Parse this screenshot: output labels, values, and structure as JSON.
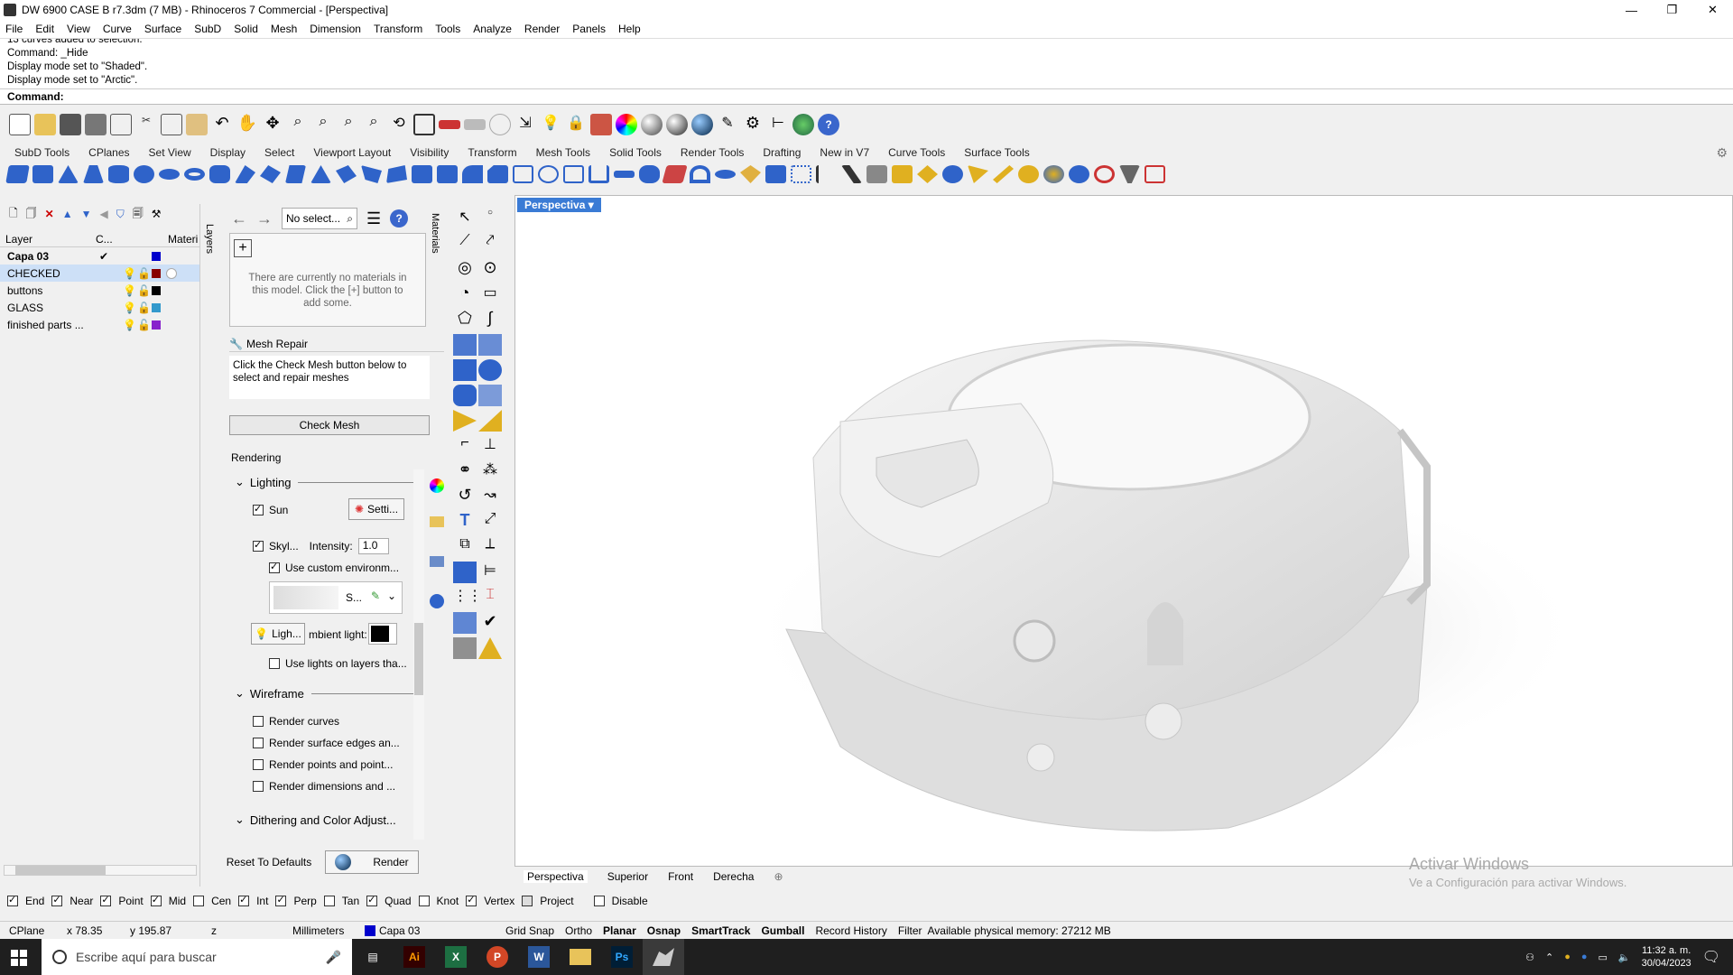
{
  "window": {
    "title": "DW 6900 CASE B r7.3dm (7 MB) - Rhinoceros 7 Commercial - [Perspectiva]",
    "controls": [
      "—",
      "❐",
      "✕"
    ]
  },
  "menu": [
    "File",
    "Edit",
    "View",
    "Curve",
    "Surface",
    "SubD",
    "Solid",
    "Mesh",
    "Dimension",
    "Transform",
    "Tools",
    "Analyze",
    "Render",
    "Panels",
    "Help"
  ],
  "command_history": [
    "13 curves added to selection.",
    "Command: _Hide",
    "Display mode set to \"Shaded\".",
    "Display mode set to \"Arctic\"."
  ],
  "command_prompt": "Command:",
  "toolbar_tabs": [
    "SubD Tools",
    "CPlanes",
    "Set View",
    "Display",
    "Select",
    "Viewport Layout",
    "Visibility",
    "Transform",
    "Mesh Tools",
    "Solid Tools",
    "Render Tools",
    "Drafting",
    "New in V7",
    "Curve Tools",
    "Surface Tools"
  ],
  "layers": {
    "headers": [
      "Layer",
      "C...",
      "Materi"
    ],
    "rows": [
      {
        "name": "Capa 03",
        "color": "#0000cc",
        "current": true
      },
      {
        "name": "CHECKED",
        "color": "#880000",
        "selected": true
      },
      {
        "name": "buttons",
        "color": "#000000"
      },
      {
        "name": "GLASS",
        "color": "#3399cc"
      },
      {
        "name": "finished parts ...",
        "color": "#8822cc"
      }
    ],
    "side_tab": "Layers"
  },
  "materials": {
    "search_placeholder": "No select...",
    "side_tab": "Materials",
    "empty_text": "There are currently no materials in this model. Click the [+] button to add some."
  },
  "mesh_repair": {
    "title": "Mesh Repair",
    "text": "Click the Check Mesh button below to select and repair meshes",
    "button": "Check Mesh"
  },
  "rendering": {
    "title": "Rendering",
    "lighting": "Lighting",
    "sun": "Sun",
    "sun_settings": "Setti...",
    "skylight": "Skyl...",
    "intensity_label": "Intensity:",
    "intensity_value": "1.0",
    "custom_env": "Use custom environm...",
    "env_label": "S...",
    "lights_btn": "Ligh...",
    "ambient": "mbient light:",
    "use_layers": "Use lights on layers tha...",
    "wireframe": "Wireframe",
    "render_curves": "Render curves",
    "render_edges": "Render surface edges an...",
    "render_points": "Render points and point...",
    "render_dims": "Render dimensions and ...",
    "dithering": "Dithering and Color Adjust...",
    "reset": "Reset To Defaults",
    "render_btn": "Render"
  },
  "viewport": {
    "active_tab": "Perspectiva",
    "tabs": [
      "Perspectiva",
      "Superior",
      "Front",
      "Derecha"
    ],
    "watermark_title": "Activar Windows",
    "watermark_sub": "Ve a Configuración para activar Windows."
  },
  "osnap": [
    {
      "label": "End",
      "on": true
    },
    {
      "label": "Near",
      "on": true
    },
    {
      "label": "Point",
      "on": true
    },
    {
      "label": "Mid",
      "on": true
    },
    {
      "label": "Cen",
      "on": false
    },
    {
      "label": "Int",
      "on": true
    },
    {
      "label": "Perp",
      "on": true
    },
    {
      "label": "Tan",
      "on": false
    },
    {
      "label": "Quad",
      "on": true
    },
    {
      "label": "Knot",
      "on": false
    },
    {
      "label": "Vertex",
      "on": true
    },
    {
      "label": "Project",
      "on": false
    },
    {
      "label": "Disable",
      "on": false
    }
  ],
  "status": {
    "cplane": "CPlane",
    "x": "x 78.35",
    "y": "y 195.87",
    "z": "z",
    "units": "Millimeters",
    "layer": "Capa 03",
    "toggles": [
      "Grid Snap",
      "Ortho",
      "Planar",
      "Osnap",
      "SmartTrack",
      "Gumball",
      "Record History",
      "Filter"
    ],
    "memory": "Available physical memory: 27212 MB"
  },
  "taskbar": {
    "search_placeholder": "Escribe aquí para buscar",
    "time": "11:32 a. m.",
    "date": "30/04/2023"
  },
  "colors": {
    "accent": "#3a7bd5",
    "selection": "#cde0f7",
    "taskbar": "#1f1f1f"
  }
}
